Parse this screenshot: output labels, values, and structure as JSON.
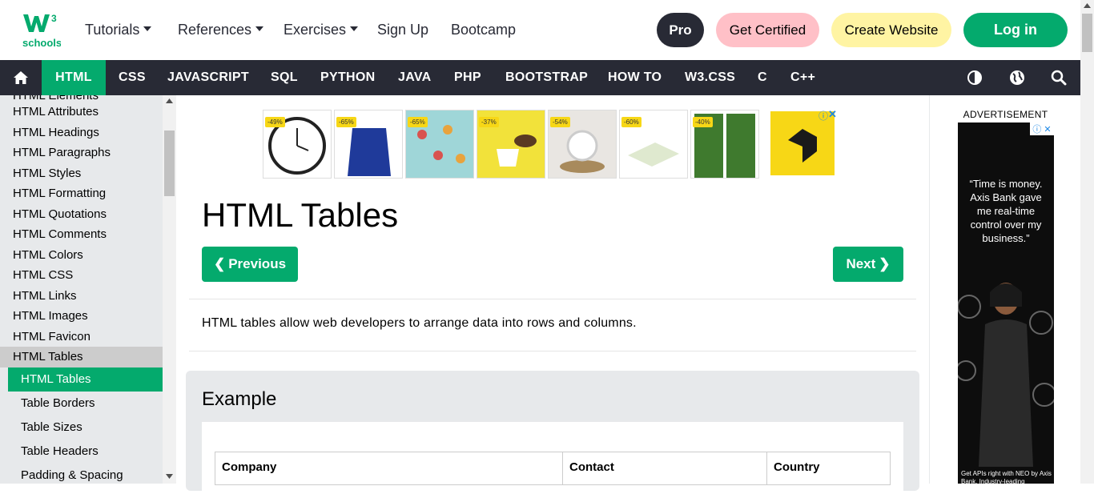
{
  "topbar": {
    "logo_sup": "3",
    "logo_text": "schools",
    "nav": [
      {
        "label": "Tutorials",
        "dropdown": true
      },
      {
        "label": "References",
        "dropdown": true
      },
      {
        "label": "Exercises",
        "dropdown": true
      },
      {
        "label": "Sign Up",
        "dropdown": false
      },
      {
        "label": "Bootcamp",
        "dropdown": false
      }
    ],
    "pro_label": "Pro",
    "certified_label": "Get Certified",
    "create_label": "Create Website",
    "login_label": "Log in"
  },
  "navbar": {
    "items": [
      "HTML",
      "CSS",
      "JAVASCRIPT",
      "SQL",
      "PYTHON",
      "JAVA",
      "PHP",
      "BOOTSTRAP",
      "HOW TO",
      "W3.CSS",
      "C",
      "C++"
    ],
    "active": "HTML",
    "icons": [
      "home-icon",
      "contrast-icon",
      "globe-icon",
      "search-icon"
    ]
  },
  "sidebar": {
    "partial_top": "HTML Elements",
    "items": [
      "HTML Attributes",
      "HTML Headings",
      "HTML Paragraphs",
      "HTML Styles",
      "HTML Formatting",
      "HTML Quotations",
      "HTML Comments",
      "HTML Colors",
      "HTML CSS",
      "HTML Links",
      "HTML Images",
      "HTML Favicon",
      "HTML Tables"
    ],
    "subitems": [
      "HTML Tables",
      "Table Borders",
      "Table Sizes",
      "Table Headers",
      "Padding & Spacing"
    ],
    "active_sub": "HTML Tables"
  },
  "ad_strip": {
    "discounts": [
      "-49%",
      "-65%",
      "-65%",
      "-37%",
      "-54%",
      "-60%",
      "-40%"
    ]
  },
  "main": {
    "title": "HTML Tables",
    "previous_label": "Previous",
    "next_label": "Next",
    "intro": "HTML tables allow web developers to arrange data into rows and columns.",
    "example_heading": "Example",
    "table_headers": [
      "Company",
      "Contact",
      "Country"
    ]
  },
  "right_ad": {
    "label": "ADVERTISEMENT",
    "quote": "“Time is money. Axis Bank gave me real-time control over my business.”",
    "footer": "Get APIs right with NEO by Axis Bank. Industry-leading"
  },
  "colors": {
    "brand_green": "#04aa6d",
    "dark": "#282a35",
    "pink": "#ffc0c7",
    "yellow": "#fff4a3",
    "sidebar_bg": "#e7e9eb"
  }
}
